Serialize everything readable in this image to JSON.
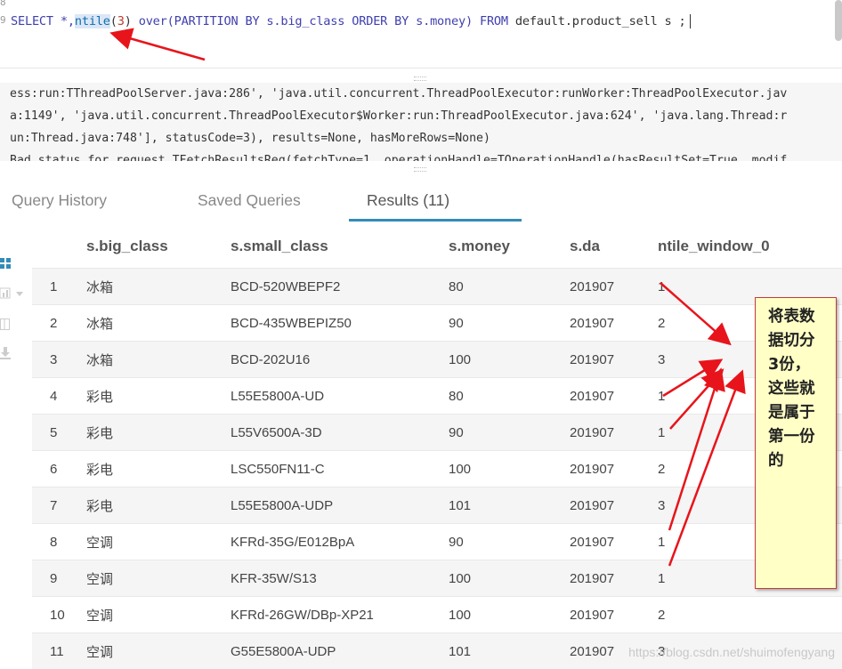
{
  "editor": {
    "line_numbers": [
      "8",
      "9"
    ],
    "sql_parts": {
      "p1": "SELECT *,",
      "fn": "ntile",
      "p2": "(",
      "arg": "3",
      "p3": ") ",
      "p4": "over",
      "p5": "(PARTITION BY s.big_class ORDER BY s.money) ",
      "p6": "FROM",
      "p7": " default.product_sell s ;"
    }
  },
  "log": {
    "lines": [
      "ess:run:TThreadPoolServer.java:286', 'java.util.concurrent.ThreadPoolExecutor:runWorker:ThreadPoolExecutor.jav",
      "a:1149', 'java.util.concurrent.ThreadPoolExecutor$Worker:run:ThreadPoolExecutor.java:624', 'java.lang.Thread:r",
      "un:Thread.java:748'], statusCode=3), results=None, hasMoreRows=None)",
      "Bad status for request TFetchResultsReq(fetchType=1, operationHandle=TOperationHandle(hasResultSet=True, modif"
    ]
  },
  "tabs": {
    "query_history": "Query History",
    "saved_queries": "Saved Queries",
    "results": "Results (11)"
  },
  "sidebar_icons": [
    "grid-icon",
    "chart-icon",
    "table-view-icon",
    "download-icon"
  ],
  "results": {
    "columns": [
      "s.big_class",
      "s.small_class",
      "s.money",
      "s.da",
      "ntile_window_0"
    ],
    "rows": [
      [
        "1",
        "冰箱",
        "BCD-520WBEPF2",
        "80",
        "201907",
        "1"
      ],
      [
        "2",
        "冰箱",
        "BCD-435WBEPIZ50",
        "90",
        "201907",
        "2"
      ],
      [
        "3",
        "冰箱",
        "BCD-202U16",
        "100",
        "201907",
        "3"
      ],
      [
        "4",
        "彩电",
        "L55E5800A-UD",
        "80",
        "201907",
        "1"
      ],
      [
        "5",
        "彩电",
        "L55V6500A-3D",
        "90",
        "201907",
        "1"
      ],
      [
        "6",
        "彩电",
        "LSC550FN11-C",
        "100",
        "201907",
        "2"
      ],
      [
        "7",
        "彩电",
        "L55E5800A-UDP",
        "101",
        "201907",
        "3"
      ],
      [
        "8",
        "空调",
        "KFRd-35G/E012BpA",
        "90",
        "201907",
        "1"
      ],
      [
        "9",
        "空调",
        "KFR-35W/S13",
        "100",
        "201907",
        "1"
      ],
      [
        "10",
        "空调",
        "KFRd-26GW/DBp-XP21",
        "100",
        "201907",
        "2"
      ],
      [
        "11",
        "空调",
        "G55E5800A-UDP",
        "101",
        "201907",
        "3"
      ]
    ]
  },
  "annotation": {
    "lines": [
      "将表数",
      "据切分",
      "3份，",
      "这些就",
      "是属于",
      "第一份",
      "的"
    ],
    "border_color": "#c23b3b",
    "fill_color": "#ffffc6",
    "arrow_color": "#e8141b"
  },
  "watermark": "https://blog.csdn.net/shuimofengyang"
}
